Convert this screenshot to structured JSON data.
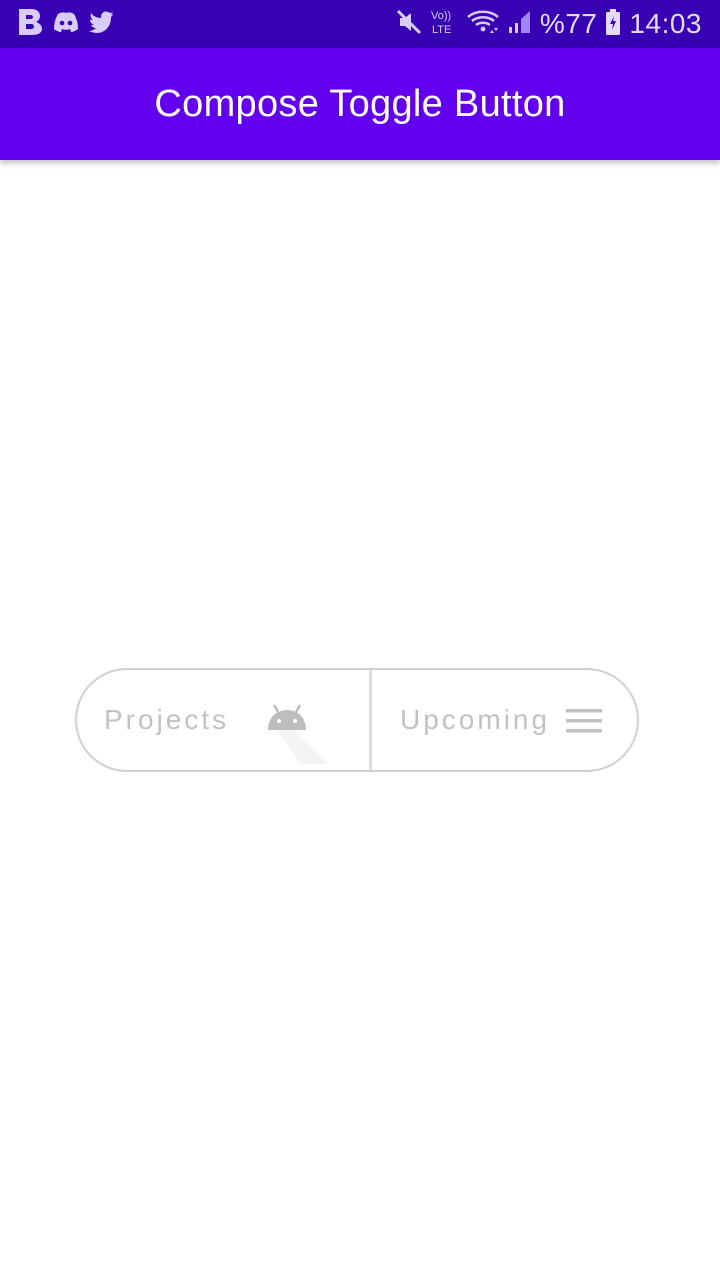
{
  "status_bar": {
    "left_icons": [
      "b-icon",
      "discord-icon",
      "twitter-icon"
    ],
    "right_icons": [
      "mute-icon",
      "volte-icon",
      "wifi-icon",
      "signal-icon",
      "battery-icon"
    ],
    "volte_label_top": "Vo))",
    "volte_label_bottom": "LTE",
    "battery": "%77",
    "time": "14:03"
  },
  "app_bar": {
    "title": "Compose Toggle Button"
  },
  "toggle": {
    "left": {
      "label": "Projects",
      "icon": "android-icon"
    },
    "right": {
      "label": "Upcoming",
      "icon": "menu-icon"
    }
  },
  "colors": {
    "status_bar": "#3700b3",
    "app_bar": "#6200ee",
    "toggle_border": "#d0d0d0",
    "toggle_text": "#c2c2c2"
  }
}
